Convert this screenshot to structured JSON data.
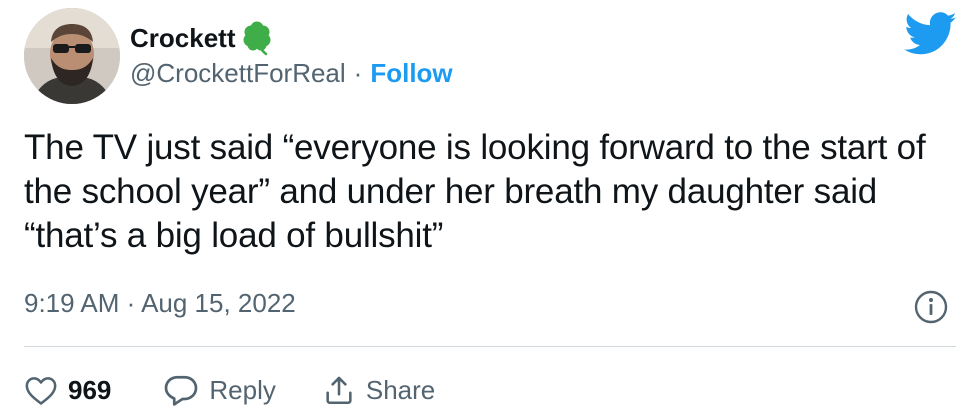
{
  "user": {
    "display_name": "Crockett",
    "name_emoji": "shamrock-icon",
    "handle": "@CrockettForReal",
    "separator": "·",
    "follow_label": "Follow",
    "avatar": "avatar-photo"
  },
  "tweet": {
    "text": "The TV just said “everyone is looking forward to the start of the school year” and under her breath my daughter said “that’s a big load of bullshit”",
    "timestamp": "9:19 AM · Aug 15, 2022"
  },
  "actions": {
    "like_count": "969",
    "reply_label": "Reply",
    "share_label": "Share"
  },
  "colors": {
    "brand": "#1d9bf0",
    "text": "#0f1419",
    "secondary": "#536471",
    "divider": "#cfd9de",
    "clover": "#3fae49"
  },
  "icons": [
    "twitter-bird-icon",
    "shamrock-icon",
    "info-icon",
    "heart-icon",
    "reply-bubble-icon",
    "share-icon"
  ]
}
